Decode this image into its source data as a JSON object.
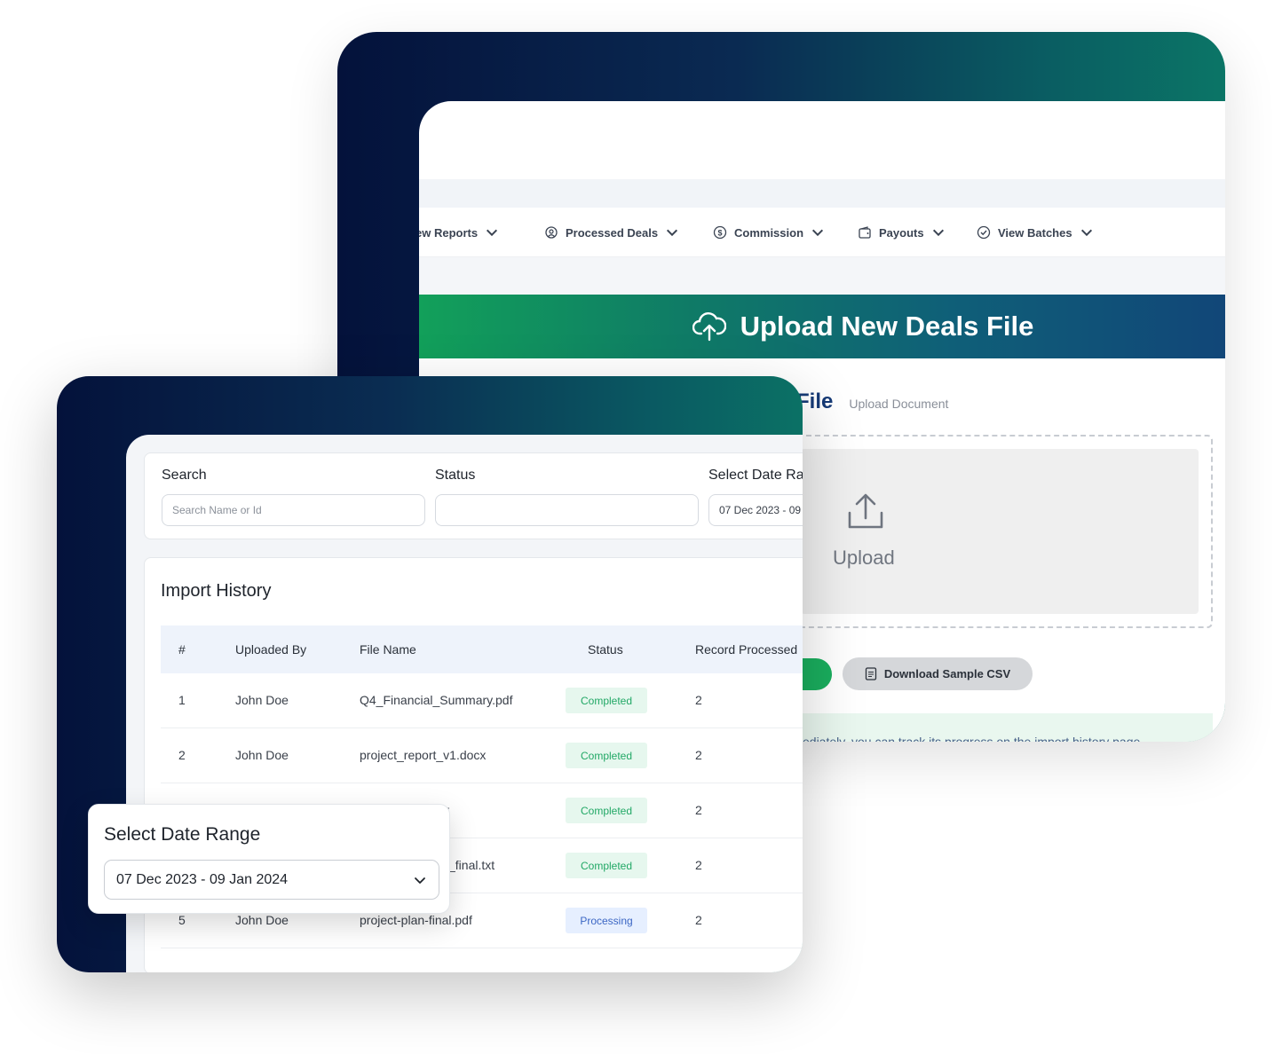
{
  "back_window": {
    "nav_items": [
      {
        "label": "ew Reports",
        "icon": "report-icon"
      },
      {
        "label": "Processed Deals",
        "icon": "deals-icon"
      },
      {
        "label": "Commission",
        "icon": "dollar-circle-icon"
      },
      {
        "label": "Payouts",
        "icon": "wallet-icon"
      },
      {
        "label": "View Batches",
        "icon": "check-circle-icon"
      }
    ],
    "banner_title": "Upload New Deals File",
    "section_title": "File",
    "section_subtitle": "Upload Document",
    "dropzone_label": "Upload",
    "download_csv_label": "Download Sample CSV",
    "note_text": "ediately, you can track its progress on the import history page."
  },
  "front_window": {
    "filters": {
      "search_label": "Search",
      "search_placeholder": "Search Name or Id",
      "status_label": "Status",
      "status_value": "",
      "date_label": "Select Date Ra",
      "date_value": "07 Dec 2023 - 09"
    },
    "history": {
      "title": "Import History",
      "columns": [
        "#",
        "Uploaded By",
        "File Name",
        "Status",
        "Record Processed"
      ],
      "rows": [
        {
          "num": "1",
          "uploaded_by": "John Doe",
          "file_name": "Q4_Financial_Summary.pdf",
          "status": "Completed",
          "records": "2"
        },
        {
          "num": "2",
          "uploaded_by": "John Doe",
          "file_name": "project_report_v1.docx",
          "status": "Completed",
          "records": "2"
        },
        {
          "num": "",
          "uploaded_by": "",
          "file_name": "v",
          "status": "Completed",
          "records": "2"
        },
        {
          "num": "",
          "uploaded_by": "",
          "file_name": "_final.txt",
          "status": "Completed",
          "records": "2"
        },
        {
          "num": "5",
          "uploaded_by": "John Doe",
          "file_name": "project-plan-final.pdf",
          "status": "Processing",
          "records": "2"
        }
      ]
    }
  },
  "date_popover": {
    "title": "Select Date Range",
    "value": "07 Dec 2023 - 09 Jan 2024"
  },
  "colors": {
    "brand_dark": "#04123b",
    "brand_teal": "#0b7566",
    "accent_green": "#1aae5e",
    "completed_text": "#22a866",
    "processing_text": "#3b66c4"
  }
}
